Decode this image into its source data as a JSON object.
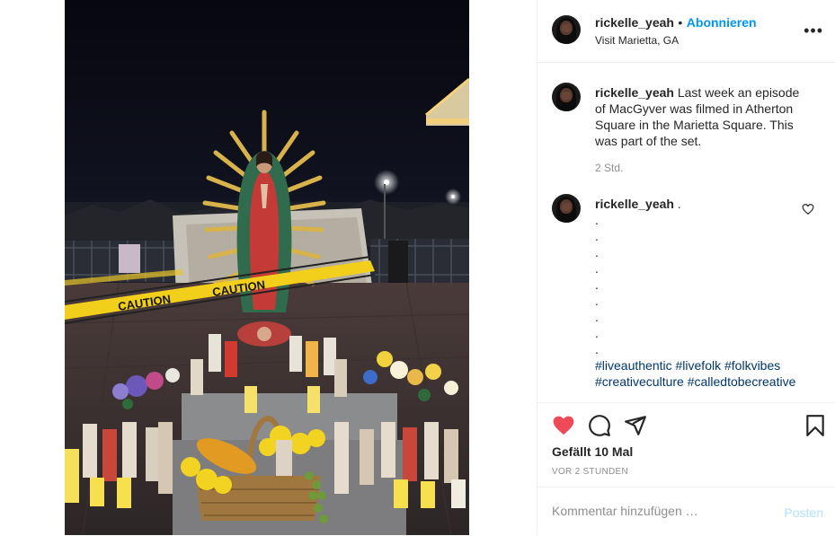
{
  "post": {
    "username": "rickelle_yeah",
    "separator": "•",
    "follow_label": "Abonnieren",
    "location": "Visit Marietta, GA",
    "more_icon": "more-options-icon",
    "more_glyph": "•••"
  },
  "caption": {
    "username": "rickelle_yeah",
    "text": "Last week an episode of MacGyver was filmed in Atherton Square in the Marietta Square. This was part of the set.",
    "time": "2 Std."
  },
  "comment": {
    "username": "rickelle_yeah",
    "first": ".",
    "dots": [
      ".",
      ".",
      ".",
      ".",
      ".",
      ".",
      ".",
      ".",
      "."
    ],
    "hashtags": [
      "#liveauthentic",
      "#livefolk",
      "#folkvibes",
      "#creativeculture",
      "#calledtobecreative"
    ]
  },
  "actions": {
    "like_icon": "heart-filled-icon",
    "comment_icon": "comment-icon",
    "share_icon": "share-icon",
    "save_icon": "bookmark-icon",
    "like_color": "#ed4956",
    "likes": "Gefällt 10 Mal",
    "timeago": "VOR 2 STUNDEN"
  },
  "comment_form": {
    "placeholder": "Kommentar hinzufügen …",
    "post_label": "Posten"
  },
  "photo": {
    "tape_text": "CAUTION"
  }
}
